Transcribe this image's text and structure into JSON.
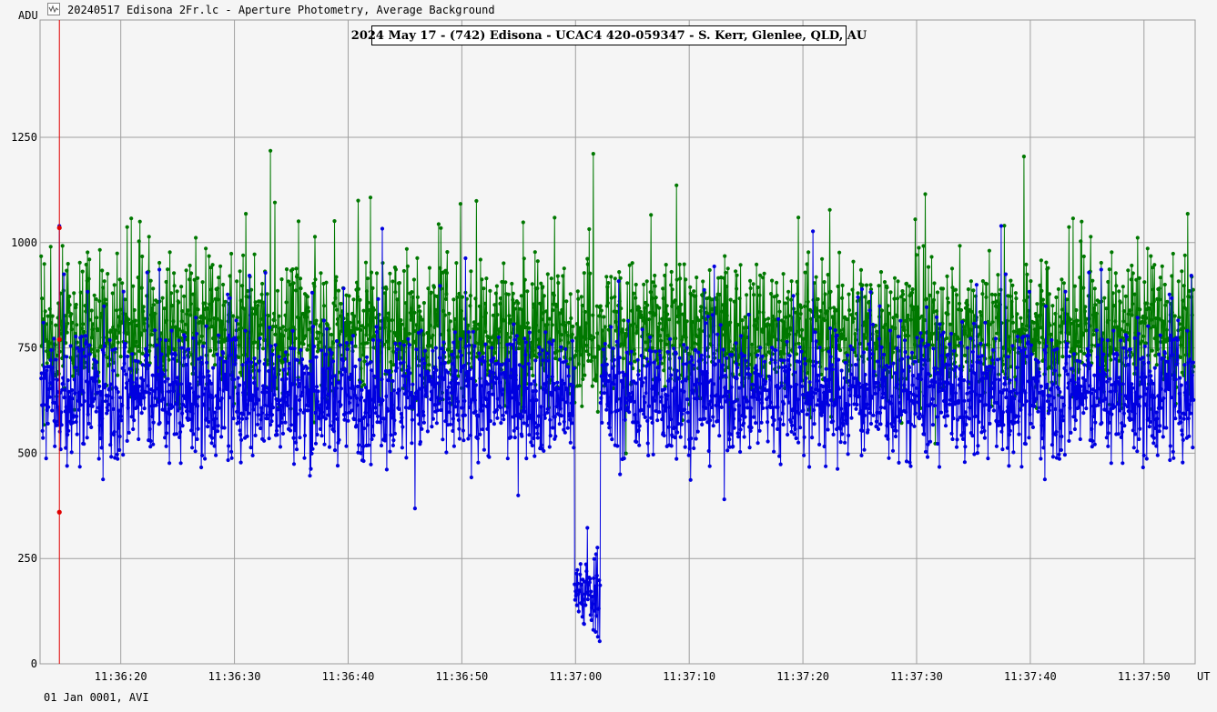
{
  "window": {
    "title": "20240517 Edisona 2Fr.lc - Aperture Photometry, Average Background",
    "icon": "lightcurve-app-icon"
  },
  "footer": {
    "date_mode": "01 Jan 0001, AVI"
  },
  "colors": {
    "background": "#f5f5f5",
    "grid": "#a0a0a0",
    "series_target": "#0000e0",
    "series_comparison": "#007800",
    "marker_line": "#e00000"
  },
  "chart_data": {
    "type": "line",
    "title": "2024 May 17 - (742) Edisona - UCAC4 420-059347 - S. Kerr, Glenlee, QLD, AU",
    "ylabel": "ADU",
    "xlabel": "UT",
    "ylim": [
      0,
      1250
    ],
    "xlim": [
      "11:36:12.9",
      "11:37:54.5"
    ],
    "y_ticks": [
      0,
      250,
      500,
      750,
      1000,
      1250
    ],
    "x_ticks": [
      "11:36:20",
      "11:36:30",
      "11:36:40",
      "11:36:50",
      "11:37:00",
      "11:37:10",
      "11:37:20",
      "11:37:30",
      "11:37:40",
      "11:37:50"
    ],
    "grid": true,
    "frame_interval_s": 0.04,
    "series": [
      {
        "role": "target",
        "color": "#0000e0",
        "baseline_adu": 640,
        "scatter_adu": 140,
        "event": {
          "start": "11:36:59.9",
          "end": "11:37:02.2",
          "level_adu": 170,
          "min_adu": 50
        }
      },
      {
        "role": "comparison",
        "color": "#007800",
        "baseline_adu": 790,
        "scatter_adu": 150,
        "max_adu": 1330
      }
    ],
    "marker_time": "11:36:14.6"
  }
}
